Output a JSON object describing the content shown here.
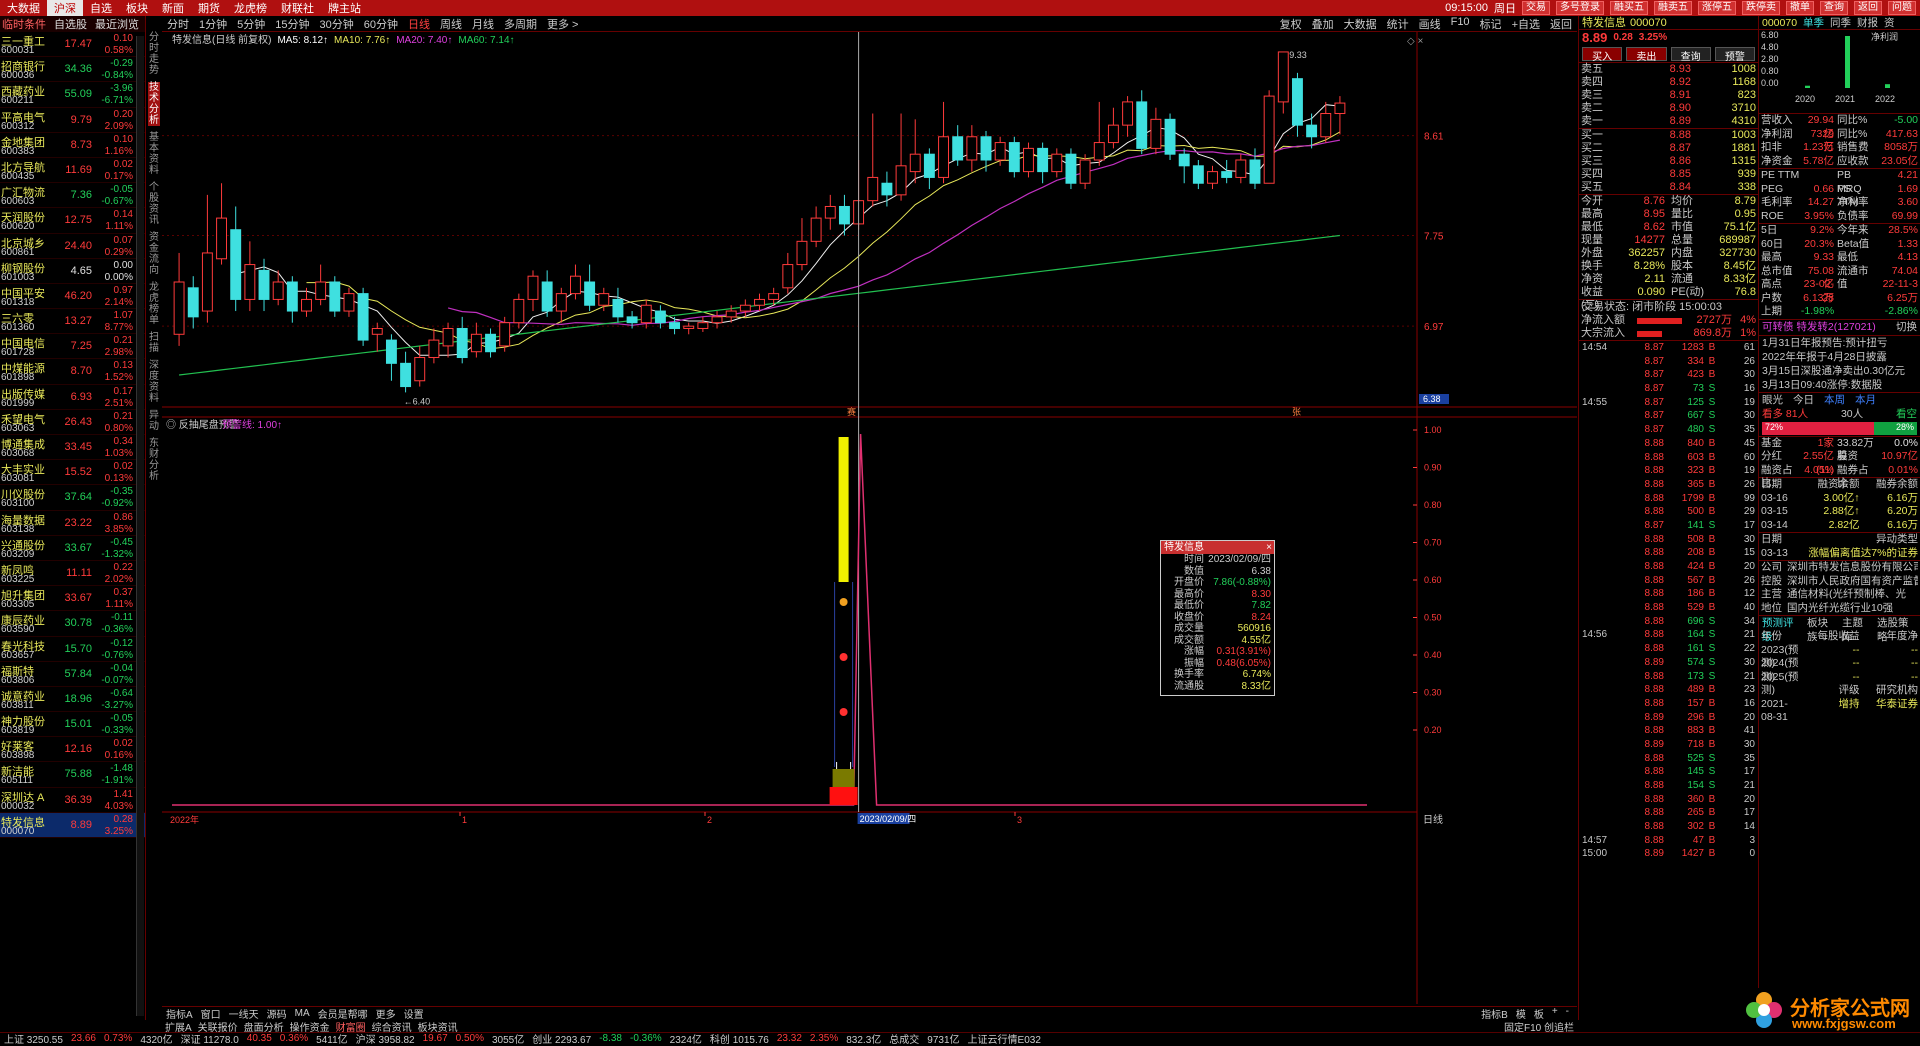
{
  "topbar": {
    "menus": [
      "大数据",
      "沪深",
      "自选",
      "板块",
      "新面",
      "期货",
      "龙虎榜",
      "财联社",
      "牌主站"
    ],
    "active": 1,
    "time": "09:15:00",
    "weekday": "周日",
    "tools": [
      "交易",
      "多号登录",
      "融买五",
      "融卖五",
      "涨停五",
      "跌停卖",
      "撤单",
      "查询",
      "返回",
      "问题"
    ]
  },
  "watch": {
    "header": [
      "临时条件",
      "自选股",
      "最近浏览"
    ],
    "rows": [
      {
        "name": "三一重工",
        "code": "600031",
        "price": "17.47",
        "chg": "0.10",
        "pct": "0.58%",
        "dir": "up"
      },
      {
        "name": "招商银行",
        "code": "600036",
        "price": "34.36",
        "chg": "-0.29",
        "pct": "-0.84%",
        "dir": "dn"
      },
      {
        "name": "西藏药业",
        "code": "600211",
        "price": "55.09",
        "chg": "-3.96",
        "pct": "-6.71%",
        "dir": "dn"
      },
      {
        "name": "平高电气",
        "code": "600312",
        "price": "9.79",
        "chg": "0.20",
        "pct": "2.09%",
        "dir": "up"
      },
      {
        "name": "金地集团",
        "code": "600383",
        "price": "8.73",
        "chg": "0.10",
        "pct": "1.16%",
        "dir": "up"
      },
      {
        "name": "北方导航",
        "code": "600435",
        "price": "11.69",
        "chg": "0.02",
        "pct": "0.17%",
        "dir": "up"
      },
      {
        "name": "广汇物流",
        "code": "600603",
        "price": "7.36",
        "chg": "-0.05",
        "pct": "-0.67%",
        "dir": "dn"
      },
      {
        "name": "天润股份",
        "code": "600620",
        "price": "12.75",
        "chg": "0.14",
        "pct": "1.11%",
        "dir": "up"
      },
      {
        "name": "北京城乡",
        "code": "600861",
        "price": "24.40",
        "chg": "0.07",
        "pct": "0.29%",
        "dir": "up"
      },
      {
        "name": "柳钢股份",
        "code": "601003",
        "price": "4.65",
        "chg": "0.00",
        "pct": "0.00%",
        "dir": "eq"
      },
      {
        "name": "中国平安",
        "code": "601318",
        "price": "46.20",
        "chg": "0.97",
        "pct": "2.14%",
        "dir": "up"
      },
      {
        "name": "三六零",
        "code": "601360",
        "price": "13.27",
        "chg": "1.07",
        "pct": "8.77%",
        "dir": "up"
      },
      {
        "name": "中国电信",
        "code": "601728",
        "price": "7.25",
        "chg": "0.21",
        "pct": "2.98%",
        "dir": "up"
      },
      {
        "name": "中煤能源",
        "code": "601898",
        "price": "8.70",
        "chg": "0.13",
        "pct": "1.52%",
        "dir": "up"
      },
      {
        "name": "出版传媒",
        "code": "601999",
        "price": "6.93",
        "chg": "0.17",
        "pct": "2.51%",
        "dir": "up"
      },
      {
        "name": "禾望电气",
        "code": "603063",
        "price": "26.43",
        "chg": "0.21",
        "pct": "0.80%",
        "dir": "up"
      },
      {
        "name": "博通集成",
        "code": "603068",
        "price": "33.45",
        "chg": "0.34",
        "pct": "1.03%",
        "dir": "up"
      },
      {
        "name": "大丰实业",
        "code": "603081",
        "price": "15.52",
        "chg": "0.02",
        "pct": "0.13%",
        "dir": "up"
      },
      {
        "name": "川仪股份",
        "code": "603100",
        "price": "37.64",
        "chg": "-0.35",
        "pct": "-0.92%",
        "dir": "dn"
      },
      {
        "name": "海量数据",
        "code": "603138",
        "price": "23.22",
        "chg": "0.86",
        "pct": "3.85%",
        "dir": "up"
      },
      {
        "name": "兴通股份",
        "code": "603209",
        "price": "33.67",
        "chg": "-0.45",
        "pct": "-1.32%",
        "dir": "dn"
      },
      {
        "name": "新凤鸣",
        "code": "603225",
        "price": "11.11",
        "chg": "0.22",
        "pct": "2.02%",
        "dir": "up"
      },
      {
        "name": "旭升集团",
        "code": "603305",
        "price": "33.67",
        "chg": "0.37",
        "pct": "1.11%",
        "dir": "up"
      },
      {
        "name": "康辰药业",
        "code": "603590",
        "price": "30.78",
        "chg": "-0.11",
        "pct": "-0.36%",
        "dir": "dn"
      },
      {
        "name": "春光科技",
        "code": "603657",
        "price": "15.70",
        "chg": "-0.12",
        "pct": "-0.76%",
        "dir": "dn"
      },
      {
        "name": "福斯特",
        "code": "603806",
        "price": "57.84",
        "chg": "-0.04",
        "pct": "-0.07%",
        "dir": "dn"
      },
      {
        "name": "诚意药业",
        "code": "603811",
        "price": "18.96",
        "chg": "-0.64",
        "pct": "-3.27%",
        "dir": "dn"
      },
      {
        "name": "神力股份",
        "code": "603819",
        "price": "15.01",
        "chg": "-0.05",
        "pct": "-0.33%",
        "dir": "dn"
      },
      {
        "name": "好莱客",
        "code": "603898",
        "price": "12.16",
        "chg": "0.02",
        "pct": "0.16%",
        "dir": "up"
      },
      {
        "name": "新洁能",
        "code": "605111",
        "price": "75.88",
        "chg": "-1.48",
        "pct": "-1.91%",
        "dir": "dn"
      },
      {
        "name": "深圳达 A",
        "code": "000032",
        "price": "36.39",
        "chg": "1.41",
        "pct": "4.03%",
        "dir": "up"
      },
      {
        "name": "特发信息",
        "code": "000070",
        "price": "8.89",
        "chg": "0.28",
        "pct": "3.25%",
        "dir": "up"
      }
    ]
  },
  "vtabs": [
    "分时走势",
    "技术分析",
    "基本资料",
    "个股资讯",
    "资金流向",
    "龙虎榜单",
    "扫描",
    "深度资料",
    "异动",
    "东财分析"
  ],
  "periodbar": {
    "items": [
      "分时",
      "1分钟",
      "5分钟",
      "15分钟",
      "30分钟",
      "60分钟",
      "日线",
      "周线",
      "月线",
      "多周期",
      "更多 >"
    ],
    "selected": 6,
    "right": [
      "复权",
      "叠加",
      "大数据",
      "统计",
      "画线",
      "F10",
      "标记",
      "+自选",
      "返回"
    ]
  },
  "main_panel": {
    "title": "特发信息(日线 前复权)",
    "ma5": "MA5: 8.12↑",
    "ma10": "MA10: 7.76↑",
    "ma20": "MA20: 7.40↑",
    "ma60": "MA60: 7.14↑",
    "high_label": "9.33",
    "low_label": "←6.40",
    "cur_price_tag": "6.38",
    "price_axis": [
      "8.61",
      "7.75",
      "6.97"
    ],
    "marker1": "赛",
    "marker2": "张"
  },
  "sub_panel": {
    "title": "反抽尾盘预警",
    "param": "预警线: 1.00↑",
    "axis": [
      "1.00",
      "0.90",
      "0.80",
      "0.70",
      "0.60",
      "0.50",
      "0.40",
      "0.30",
      "0.20"
    ]
  },
  "time_axis": {
    "labels": [
      "2022年",
      "1",
      "2",
      "3"
    ],
    "cursor": "2023/02/09/四",
    "right": "日线"
  },
  "tooltip": {
    "title": "特发信息",
    "rows": [
      [
        "时间",
        "2023/02/09/四"
      ],
      [
        "数值",
        "6.38"
      ],
      [
        "开盘价",
        "7.86(-0.88%)"
      ],
      [
        "最高价",
        "8.30"
      ],
      [
        "最低价",
        "7.82"
      ],
      [
        "收盘价",
        "8.24"
      ],
      [
        "成交量",
        "560916"
      ],
      [
        "成交额",
        "4.55亿"
      ],
      [
        "涨幅",
        "0.31(3.91%)"
      ],
      [
        "振幅",
        "0.48(6.05%)"
      ],
      [
        "换手率",
        "6.74%"
      ],
      [
        "流通股",
        "8.33亿"
      ]
    ]
  },
  "bottombar": {
    "items": [
      "指标A",
      "窗口",
      "一线天",
      "源码",
      "MA",
      "会员是帮哪",
      "更多",
      "设置"
    ],
    "right": [
      "指标B",
      "模",
      "板",
      "+",
      "-"
    ]
  },
  "bottombar2": {
    "items": [
      "扩展A",
      "关联报价",
      "盘面分析",
      "操作资金",
      "财富圈",
      "综合资讯",
      "板块资讯"
    ],
    "right": "固定F10  创追栏"
  },
  "statusbar": {
    "items": [
      "上证 3250.55",
      "23.66",
      "0.73%",
      "4320亿",
      "深证 11278.0",
      "40.35",
      "0.36%",
      "5411亿",
      "沪深 3958.82",
      "19.67",
      "0.50%",
      "3055亿",
      "创业 2293.67",
      "-8.38",
      "-0.36%",
      "2324亿",
      "科创 1015.76",
      "23.32",
      "2.35%",
      "832.3亿",
      "总成交",
      "9731亿",
      "上证云行情E032"
    ]
  },
  "quote": {
    "name": "特发信息",
    "code": "000070",
    "price": "8.89",
    "chg": "0.28",
    "pct": "3.25%",
    "buttons": [
      "买入",
      "卖出",
      "查询",
      "预警"
    ],
    "sell": [
      [
        "卖五",
        "8.93",
        "1008"
      ],
      [
        "卖四",
        "8.92",
        "1168"
      ],
      [
        "卖三",
        "8.91",
        "823"
      ],
      [
        "卖二",
        "8.90",
        "3710"
      ],
      [
        "卖一",
        "8.89",
        "4310"
      ]
    ],
    "buy": [
      [
        "买一",
        "8.88",
        "1003"
      ],
      [
        "买二",
        "8.87",
        "1881"
      ],
      [
        "买三",
        "8.86",
        "1315"
      ],
      [
        "买四",
        "8.85",
        "939"
      ],
      [
        "买五",
        "8.84",
        "338"
      ]
    ],
    "stats": [
      [
        "今开",
        "8.76",
        "均价",
        "8.79"
      ],
      [
        "最高",
        "8.95",
        "量比",
        "0.95"
      ],
      [
        "最低",
        "8.62",
        "市值",
        "75.1亿"
      ],
      [
        "现量",
        "14277",
        "总量",
        "689987"
      ],
      [
        "外盘",
        "362257",
        "内盘",
        "327730"
      ],
      [
        "换手",
        "8.28%",
        "股本",
        "8.45亿"
      ],
      [
        "净资",
        "2.11",
        "流通",
        "8.33亿"
      ],
      [
        "收益(三)",
        "0.090",
        "PE(动)",
        "76.8"
      ]
    ],
    "trade_state": "交易状态: 闭市阶段 15:00:03",
    "inflow": [
      "净流入额",
      "2727万",
      "4%"
    ],
    "block": [
      "大宗流入",
      "869.8万",
      "1%"
    ],
    "ticks": [
      [
        "14:54",
        "8.87",
        "1283",
        "B",
        "61"
      ],
      [
        "",
        "8.87",
        "334",
        "B",
        "26"
      ],
      [
        "",
        "8.87",
        "423",
        "B",
        "30"
      ],
      [
        "",
        "8.87",
        "73",
        "S",
        "16"
      ],
      [
        "14:55",
        "8.87",
        "125",
        "S",
        "19"
      ],
      [
        "",
        "8.87",
        "667",
        "S",
        "30"
      ],
      [
        "",
        "8.87",
        "480",
        "S",
        "35"
      ],
      [
        "",
        "8.88",
        "840",
        "B",
        "45"
      ],
      [
        "",
        "8.88",
        "603",
        "B",
        "60"
      ],
      [
        "",
        "8.88",
        "323",
        "B",
        "19"
      ],
      [
        "",
        "8.88",
        "365",
        "B",
        "26"
      ],
      [
        "",
        "8.88",
        "1799",
        "B",
        "99"
      ],
      [
        "",
        "8.88",
        "500",
        "B",
        "29"
      ],
      [
        "",
        "8.87",
        "141",
        "S",
        "17"
      ],
      [
        "",
        "8.88",
        "508",
        "B",
        "30"
      ],
      [
        "",
        "8.88",
        "208",
        "B",
        "15"
      ],
      [
        "",
        "8.88",
        "424",
        "B",
        "20"
      ],
      [
        "",
        "8.88",
        "567",
        "B",
        "26"
      ],
      [
        "",
        "8.88",
        "186",
        "B",
        "12"
      ],
      [
        "",
        "8.88",
        "529",
        "B",
        "40"
      ],
      [
        "",
        "8.88",
        "696",
        "S",
        "34"
      ],
      [
        "14:56",
        "8.88",
        "164",
        "S",
        "21"
      ],
      [
        "",
        "8.88",
        "161",
        "S",
        "22"
      ],
      [
        "",
        "8.89",
        "574",
        "S",
        "30"
      ],
      [
        "",
        "8.88",
        "173",
        "S",
        "21"
      ],
      [
        "",
        "8.88",
        "489",
        "B",
        "23"
      ],
      [
        "",
        "8.88",
        "157",
        "B",
        "16"
      ],
      [
        "",
        "8.89",
        "296",
        "B",
        "20"
      ],
      [
        "",
        "8.88",
        "883",
        "B",
        "41"
      ],
      [
        "",
        "8.89",
        "718",
        "B",
        "30"
      ],
      [
        "",
        "8.88",
        "525",
        "S",
        "35"
      ],
      [
        "",
        "8.88",
        "145",
        "S",
        "17"
      ],
      [
        "",
        "8.88",
        "154",
        "S",
        "21"
      ],
      [
        "",
        "8.88",
        "360",
        "B",
        "20"
      ],
      [
        "",
        "8.88",
        "265",
        "B",
        "17"
      ],
      [
        "",
        "8.88",
        "302",
        "B",
        "14"
      ],
      [
        "14:57",
        "8.88",
        "47",
        "B",
        "3"
      ],
      [
        "15:00",
        "8.89",
        "1427",
        "B",
        "0"
      ]
    ]
  },
  "fin": {
    "header": {
      "code": "000070",
      "tabs": [
        "单季",
        "同季",
        "财报",
        "资"
      ]
    },
    "chart": {
      "title": "净利润",
      "ylabels": [
        "6.80",
        "4.80",
        "2.80",
        "0.80",
        "0.00"
      ],
      "xlabels": [
        "2020",
        "2021",
        "2022"
      ],
      "values": [
        0.3,
        6.8,
        0.5
      ]
    },
    "rows1": [
      [
        "营收入",
        "29.94亿",
        "同比%",
        "-5.00"
      ],
      [
        "净利润",
        "7329万",
        "同比%",
        "417.63"
      ],
      [
        "扣非",
        "1.23亿",
        "销售费",
        "8058万"
      ],
      [
        "净资金",
        "5.78亿",
        "应收款",
        "23.05亿"
      ]
    ],
    "rows2": [
      [
        "PE TTM",
        "",
        "PB MRQ",
        "4.21"
      ],
      [
        "PEG",
        "0.66",
        "PS TTM",
        "1.69"
      ],
      [
        "毛利率",
        "14.27",
        "净利率",
        "3.60"
      ],
      [
        "ROE",
        "3.95%",
        "负债率",
        "69.99"
      ]
    ],
    "rows3": [
      [
        "5日",
        "9.2%",
        "今年来",
        "28.5%"
      ],
      [
        "60日",
        "20.3%",
        "Beta值",
        "1.33"
      ],
      [
        "最高",
        "9.33",
        "最低",
        "4.13"
      ],
      [
        "总市值",
        "75.08亿",
        "流通市值",
        "74.04"
      ],
      [
        "高点",
        "23-02-28",
        "",
        "22-11-3"
      ],
      [
        "户数",
        "6.13万",
        "",
        "6.25万"
      ],
      [
        "上期",
        "-1.98%",
        "",
        "-2.86%"
      ]
    ],
    "bond": "可转债 特发转2(127021)",
    "bond_action": "切换",
    "news": [
      "1月31日年报预告:预计扭亏",
      "2022年年报于4月28日披露",
      "3月15日深股通净卖出0.30亿元",
      "3月13日09:40涨停:数据股"
    ],
    "view": [
      "眼光",
      "今日",
      "本周",
      "本月"
    ],
    "view2": [
      "看多 81人",
      "30人",
      "看空"
    ],
    "bar_red": "72%",
    "bar_green": "28%",
    "funds": [
      [
        "基金",
        "1家",
        "33.82万股",
        "0.0%"
      ],
      [
        "分红",
        "2.55亿(11)",
        "募资",
        "10.97亿"
      ],
      [
        "融资占比",
        "4.05%",
        "融券占比",
        "0.01%"
      ]
    ],
    "margin_hdr": [
      "日期",
      "融资余额",
      "融券余额"
    ],
    "margin": [
      [
        "03-16",
        "3.00亿↑",
        "6.16万"
      ],
      [
        "03-15",
        "2.88亿↑",
        "6.20万"
      ],
      [
        "03-14",
        "2.82亿",
        "6.16万"
      ]
    ],
    "move_hdr": [
      "日期",
      "异动类型"
    ],
    "move": [
      [
        "03-13",
        "涨幅偏离值达7%的证券"
      ]
    ],
    "company": [
      [
        "公司",
        "深圳市特发信息股份有限公司"
      ],
      [
        "控股",
        "深圳市人民政府国有资产监督"
      ],
      [
        "主营",
        "通信材料(光纤预制棒、光"
      ],
      [
        "地位",
        "国内光纤光缆行业10强"
      ]
    ],
    "tabs2": [
      "预测评级",
      "板块族",
      "主题库",
      "选股策略"
    ],
    "eps_hdr": [
      "年份",
      "每股收益",
      "年度净"
    ],
    "eps": [
      [
        "2023(预测)",
        "--",
        "--"
      ],
      [
        "2024(预测)",
        "--",
        "--"
      ],
      [
        "2025(预测)",
        "--",
        "--"
      ]
    ],
    "rating_hdr": [
      "",
      "评级",
      "研究机构"
    ],
    "rating": [
      [
        "2021-08-31",
        "增持",
        "华泰证券"
      ]
    ]
  },
  "logo": {
    "text": "分析家公式网",
    "url": "www.fxjgsw.com"
  },
  "colors": {
    "up": "#ff3b3b",
    "down": "#22d05a",
    "bg": "#000000",
    "brand": "#b01010",
    "cyan": "#3fe0e0"
  }
}
